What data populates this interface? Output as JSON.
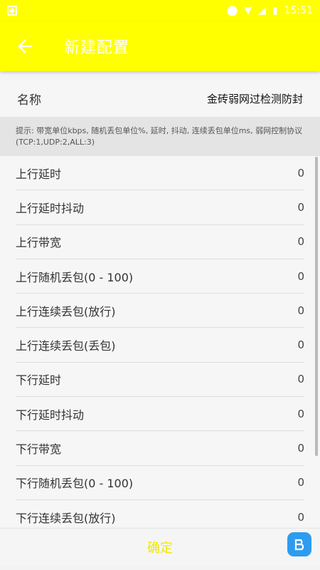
{
  "status_bar": {
    "time": "15:51"
  },
  "app_bar": {
    "title": "新建配置"
  },
  "name_row": {
    "label": "名称",
    "value": "金砖弱网过检测防封"
  },
  "hint": "提示: 带宽单位kbps, 随机丢包单位%, 延时, 抖动, 连续丢包单位ms, 弱网控制协议(TCP:1,UDP:2,ALL:3)",
  "rows": [
    {
      "label": "上行延时",
      "value": "0"
    },
    {
      "label": "上行延时抖动",
      "value": "0"
    },
    {
      "label": "上行带宽",
      "value": "0"
    },
    {
      "label": "上行随机丢包(0 - 100)",
      "value": "0"
    },
    {
      "label": "上行连续丢包(放行)",
      "value": "0"
    },
    {
      "label": "上行连续丢包(丢包)",
      "value": "0"
    },
    {
      "label": "下行延时",
      "value": "0"
    },
    {
      "label": "下行延时抖动",
      "value": "0"
    },
    {
      "label": "下行带宽",
      "value": "0"
    },
    {
      "label": "下行随机丢包(0 - 100)",
      "value": "0"
    },
    {
      "label": "下行连续丢包(放行)",
      "value": "0"
    }
  ],
  "footer": {
    "confirm_label": "确定"
  },
  "colors": {
    "accent": "#ffff00",
    "hint_bg": "#e4e4e4"
  }
}
